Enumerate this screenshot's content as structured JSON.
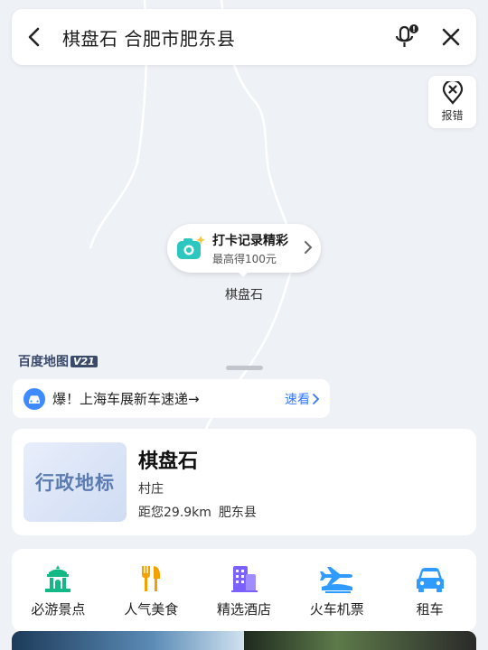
{
  "search": {
    "query": "棋盘石 合肥市肥东县"
  },
  "report": {
    "label": "报错"
  },
  "map": {
    "checkin_title": "打卡记录精彩",
    "checkin_subtitle": "最高得100元",
    "place_label": "棋盘石",
    "logo_text": "百度地图",
    "logo_version": "V21"
  },
  "banner": {
    "text": "爆！上海车展新车速递→",
    "link_label": "速看"
  },
  "info": {
    "badge": "行政地标",
    "title": "棋盘石",
    "type": "村庄",
    "distance": "距您29.9km",
    "county": "肥东县"
  },
  "categories": [
    {
      "label": "必游景点",
      "icon": "landmark-icon",
      "color": "#12b886"
    },
    {
      "label": "人气美食",
      "icon": "food-icon",
      "color": "#f59f00"
    },
    {
      "label": "精选酒店",
      "icon": "hotel-icon",
      "color": "#7b61ff"
    },
    {
      "label": "火车机票",
      "icon": "train-plane-icon",
      "color": "#2f9bff"
    },
    {
      "label": "租车",
      "icon": "car-icon",
      "color": "#2f9bff"
    }
  ],
  "colors": {
    "accent": "#3377ff",
    "map_bg": "#eef1f6"
  }
}
